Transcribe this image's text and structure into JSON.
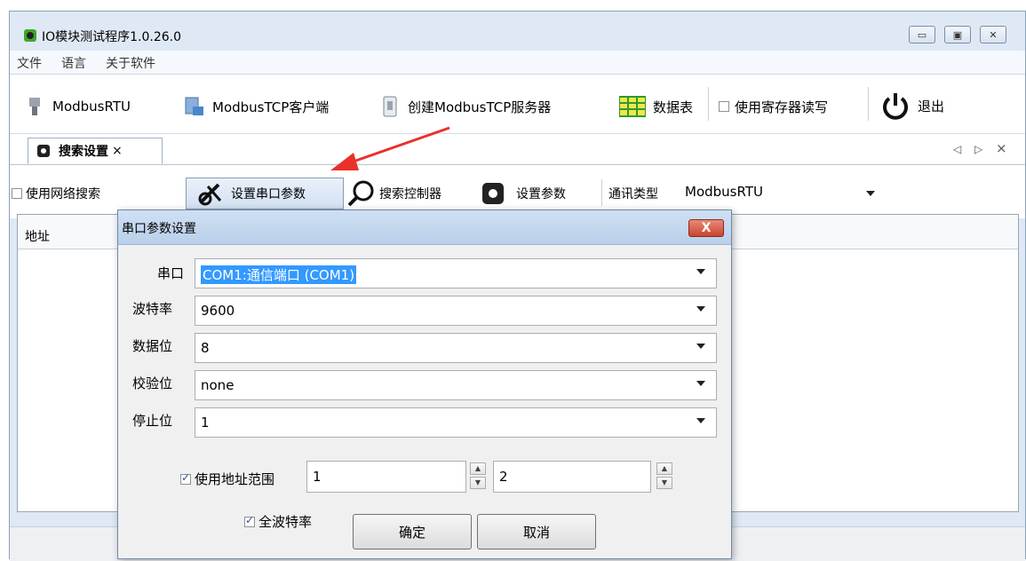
{
  "window": {
    "title": "IO模块测试程序1.0.26.0"
  },
  "menu": {
    "items": [
      "文件",
      "语言",
      "关于软件"
    ]
  },
  "toolbar": {
    "modbus_rtu": "ModbusRTU",
    "modbus_tcp_client": "ModbusTCP客户端",
    "create_tcp_server": "创建ModbusTCP服务器",
    "data_table": "数据表",
    "use_register": "使用寄存器读写",
    "exit": "退出"
  },
  "tab": {
    "label": "搜索设置",
    "close": "×",
    "nav_left": "◁",
    "nav_right": "▷",
    "nav_close": "×"
  },
  "search_bar": {
    "network_search": "使用网络搜索",
    "set_serial": "设置串口参数",
    "search_controller": "搜索控制器",
    "set_params": "设置参数",
    "comm_type_label": "通讯类型",
    "comm_type_value": "ModbusRTU"
  },
  "grid": {
    "col_address": "地址"
  },
  "dialog": {
    "title": "串口参数设置",
    "close": "X",
    "port_label": "串口",
    "port_value": "COM1:通信端口 (COM1)",
    "baud_label": "波特率",
    "baud_value": "9600",
    "databits_label": "数据位",
    "databits_value": "8",
    "parity_label": "校验位",
    "parity_value": "none",
    "stopbits_label": "停止位",
    "stopbits_value": "1",
    "use_range_label": "使用地址范围",
    "use_range_checked": true,
    "range_from": "1",
    "range_to": "2",
    "all_baud_label": "全波特率",
    "all_baud_checked": true,
    "ok": "确定",
    "cancel": "取消"
  },
  "colors": {
    "annotation_arrow": "#e8312a",
    "dialog_close": "#c9442f",
    "selection": "#3399ff"
  }
}
